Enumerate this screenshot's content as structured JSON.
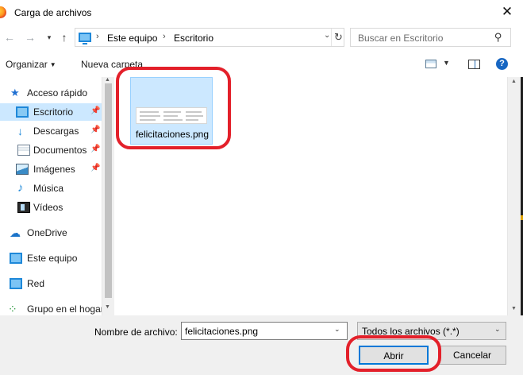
{
  "window": {
    "title": "Carga de archivos",
    "close_glyph": "✕"
  },
  "navigation": {
    "breadcrumb": [
      "Este equipo",
      "Escritorio"
    ],
    "search_placeholder": "Buscar en Escritorio"
  },
  "toolbar": {
    "organize_label": "Organizar",
    "new_folder_label": "Nueva carpeta"
  },
  "sidebar": {
    "items": [
      {
        "label": "Acceso rápido",
        "icon": "star-icon"
      },
      {
        "label": "Escritorio",
        "icon": "desktop-icon",
        "pinned": true,
        "selected": true
      },
      {
        "label": "Descargas",
        "icon": "download-icon",
        "pinned": true
      },
      {
        "label": "Documentos",
        "icon": "document-icon",
        "pinned": true
      },
      {
        "label": "Imágenes",
        "icon": "image-icon",
        "pinned": true
      },
      {
        "label": "Música",
        "icon": "music-icon"
      },
      {
        "label": "Vídeos",
        "icon": "video-icon"
      },
      {
        "label": "OneDrive",
        "icon": "onedrive-icon"
      },
      {
        "label": "Este equipo",
        "icon": "computer-icon"
      },
      {
        "label": "Red",
        "icon": "network-icon"
      },
      {
        "label": "Grupo en el hogar",
        "icon": "homegroup-icon"
      }
    ]
  },
  "files": [
    {
      "name": "felicitaciones.png",
      "selected": true
    }
  ],
  "footer": {
    "filename_label": "Nombre de archivo:",
    "filename_value": "felicitaciones.png",
    "filter_value": "Todos los archivos (*.*)",
    "open_label": "Abrir",
    "cancel_label": "Cancelar"
  },
  "colors": {
    "selection": "#cce8ff",
    "accent": "#0078d7",
    "annotation": "#e3202a"
  }
}
